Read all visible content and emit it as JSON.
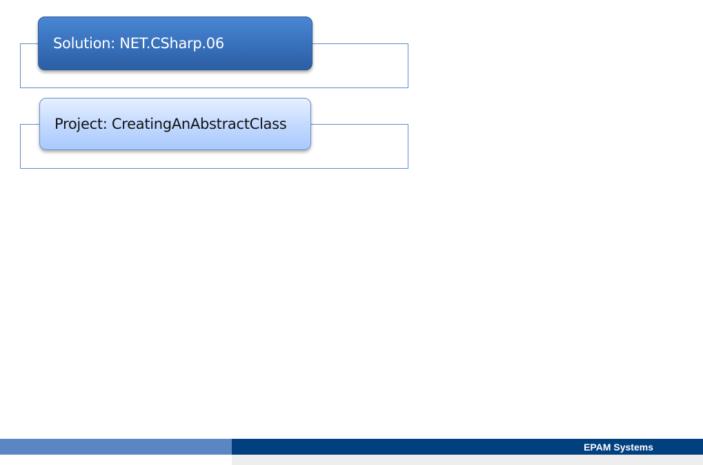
{
  "slide": {
    "solution_label": "Solution: NET.CSharp.06",
    "project_label": "Project: CreatingAnAbstractClass"
  },
  "footer": {
    "brand": "EPAM Systems"
  },
  "colors": {
    "solution_box": "#3a74c0",
    "project_box": "#c4daff",
    "frame_border": "#5a8ac6",
    "footer_left": "#5b86c4",
    "footer_right": "#00407f"
  }
}
